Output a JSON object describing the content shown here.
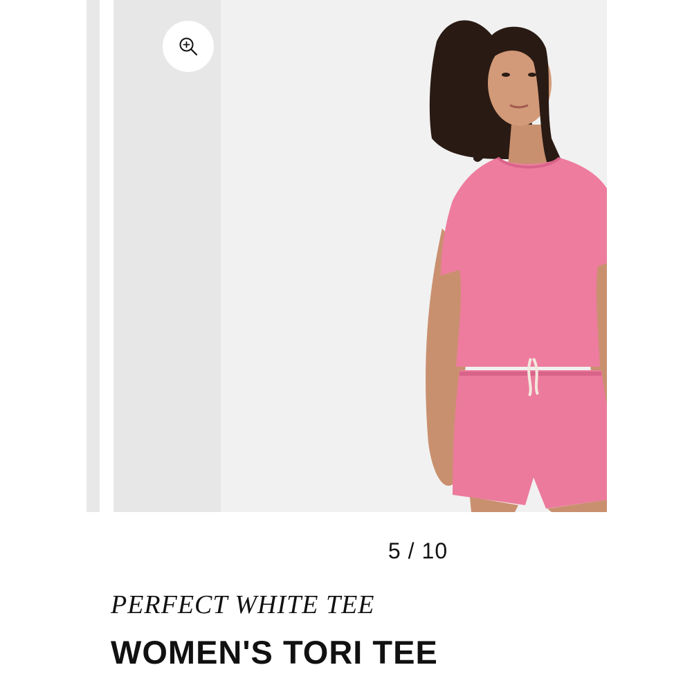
{
  "gallery": {
    "zoom_button": {
      "icon": "zoom-in-icon"
    },
    "current_image_alt": "Woman wearing pink cropped tee and pink drawstring shorts",
    "pager": {
      "current": "5",
      "separator": "/",
      "total": "10"
    }
  },
  "product": {
    "brand": "PERFECT WHITE TEE",
    "title": "WOMEN'S TORI TEE"
  },
  "colors": {
    "garment": "#ee7c9e",
    "slide_bg": "#f1f1f1",
    "side_slide_bg": "#e7e7e7",
    "text": "#111111"
  }
}
